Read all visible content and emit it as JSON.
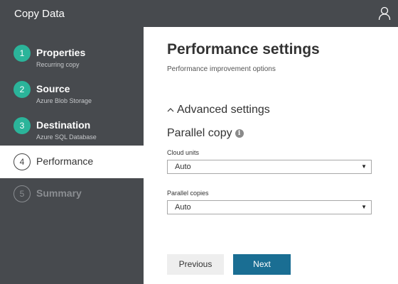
{
  "app": {
    "title": "Copy Data",
    "user_icon": "user-icon"
  },
  "steps": [
    {
      "number": "1",
      "name": "Properties",
      "sub": "Recurring copy",
      "state": "done"
    },
    {
      "number": "2",
      "name": "Source",
      "sub": "Azure Blob Storage",
      "state": "done"
    },
    {
      "number": "3",
      "name": "Destination",
      "sub": "Azure SQL Database",
      "state": "done"
    },
    {
      "number": "4",
      "name": "Performance",
      "sub": "",
      "state": "active"
    },
    {
      "number": "5",
      "name": "Summary",
      "sub": "",
      "state": "pending"
    }
  ],
  "main": {
    "title": "Performance settings",
    "subtitle": "Performance improvement options",
    "advanced_label": "Advanced settings",
    "advanced_icon": "chevron-up-icon",
    "section_title": "Parallel copy",
    "section_icon": "info-icon",
    "info_glyph": "i",
    "fields": [
      {
        "label": "Cloud units",
        "value": "Auto"
      },
      {
        "label": "Parallel copies",
        "value": "Auto"
      }
    ],
    "dropdown_arrow": "▼",
    "previous_label": "Previous",
    "next_label": "Next"
  },
  "colors": {
    "sidebar_bg": "#474a4e",
    "step_done": "#2bb49a",
    "next_button": "#1a6e93",
    "previous_button": "#eeeeee"
  }
}
